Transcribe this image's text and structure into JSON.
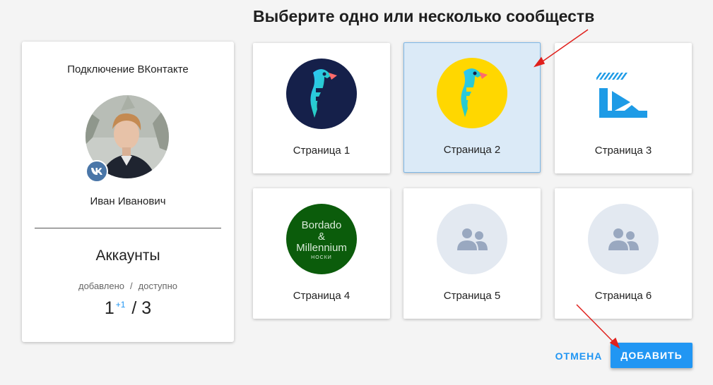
{
  "header": {
    "title": "Выберите одно или несколько сообществ"
  },
  "account": {
    "title": "Подключение ВКонтакте",
    "user_name": "Иван Иванович",
    "network_icon": "vk-icon",
    "accounts_title": "Аккаунты",
    "added_label": "добавлено",
    "separator": "/",
    "available_label": "доступно",
    "count_added": "1",
    "count_delta": "+1",
    "count_available": "/ 3"
  },
  "pages": [
    {
      "label": "Страница 1",
      "logo": "parrot-logo-navy",
      "selected": false
    },
    {
      "label": "Страница 2",
      "logo": "parrot-logo-yellow",
      "selected": true
    },
    {
      "label": "Страница 3",
      "logo": "play-logo-blue",
      "selected": false
    },
    {
      "label": "Страница 4",
      "logo": "bordado-logo",
      "selected": false,
      "logo_lines": [
        "Bordado",
        "&",
        "Millennium",
        "НОСКИ"
      ]
    },
    {
      "label": "Страница 5",
      "logo": "group-placeholder-icon",
      "selected": false
    },
    {
      "label": "Страница 6",
      "logo": "group-placeholder-icon",
      "selected": false
    }
  ],
  "actions": {
    "cancel": "ОТМЕНА",
    "add": "ДОБАВИТЬ"
  },
  "colors": {
    "accent": "#2196f3",
    "selected_bg": "#dbeaf7",
    "arrow": "#e0201c",
    "vk": "#4a76a8"
  }
}
